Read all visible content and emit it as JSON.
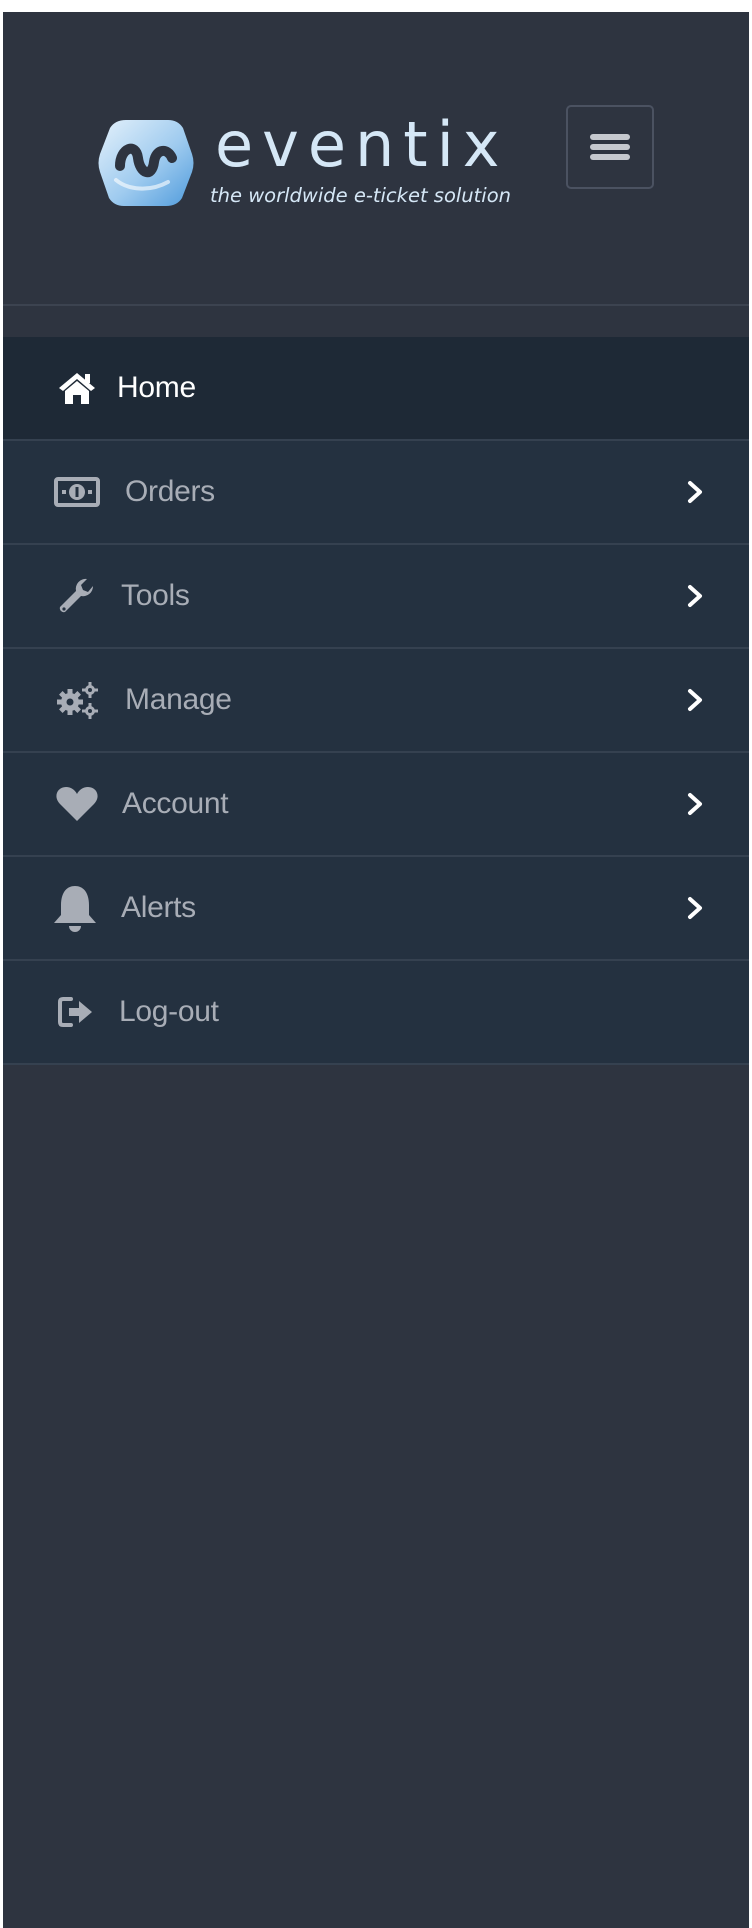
{
  "brand": {
    "name": "eventix",
    "tagline": "the worldwide e-ticket solution",
    "logo_icon": "eventix-logo-mark",
    "colors": {
      "word": "#d5e7f6",
      "mark_light": "#cfe6f8",
      "mark_dark": "#5aa3df"
    }
  },
  "header": {
    "toggle_icon": "hamburger-icon"
  },
  "menu": {
    "items": [
      {
        "label": "Home",
        "icon": "home-icon",
        "active": true,
        "has_submenu": false
      },
      {
        "label": "Orders",
        "icon": "money-icon",
        "active": false,
        "has_submenu": true
      },
      {
        "label": "Tools",
        "icon": "wrench-icon",
        "active": false,
        "has_submenu": true
      },
      {
        "label": "Manage",
        "icon": "gears-icon",
        "active": false,
        "has_submenu": true
      },
      {
        "label": "Account",
        "icon": "heart-icon",
        "active": false,
        "has_submenu": true
      },
      {
        "label": "Alerts",
        "icon": "bell-icon",
        "active": false,
        "has_submenu": true
      },
      {
        "label": "Log-out",
        "icon": "logout-icon",
        "active": false,
        "has_submenu": false
      }
    ]
  },
  "colors": {
    "sidebar_bg": "#2e3440",
    "item_bg": "#243140",
    "active_bg": "#1e2936",
    "label": "#a8adb6",
    "active_label": "#ffffff"
  }
}
